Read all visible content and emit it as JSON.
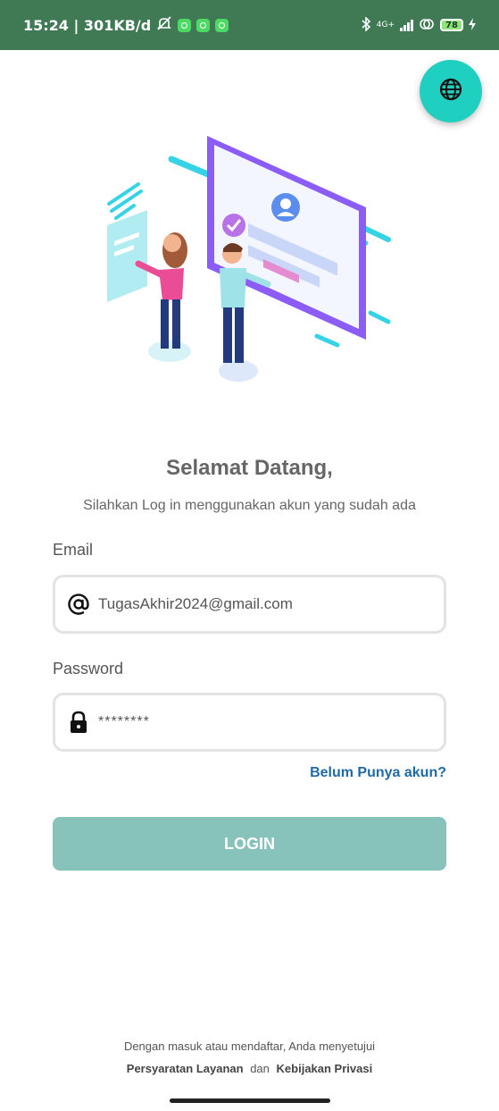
{
  "status_bar": {
    "time_speed": "15:24 | 301KB/d",
    "network": "4G+",
    "battery": "78"
  },
  "icons": {
    "globe": "globe-icon",
    "email": "at-sign-icon",
    "password": "lock-icon"
  },
  "welcome": {
    "title": "Selamat Datang,",
    "subtitle": "Silahkan Log in menggunakan akun yang sudah ada"
  },
  "form": {
    "email_label": "Email",
    "email_value": "TugasAkhir2024@gmail.com",
    "password_label": "Password",
    "password_value": "********",
    "register_link": "Belum Punya akun?",
    "login_button": "LOGIN"
  },
  "footer": {
    "line1": "Dengan masuk atau mendaftar, Anda menyetujui",
    "terms": "Persyaratan Layanan",
    "and": "dan",
    "privacy": "Kebijakan Privasi"
  },
  "colors": {
    "status_bar": "#3f7a55",
    "accent_teal": "#1fcfbf",
    "login_button": "#87c2bb",
    "link": "#1f6aa8"
  }
}
